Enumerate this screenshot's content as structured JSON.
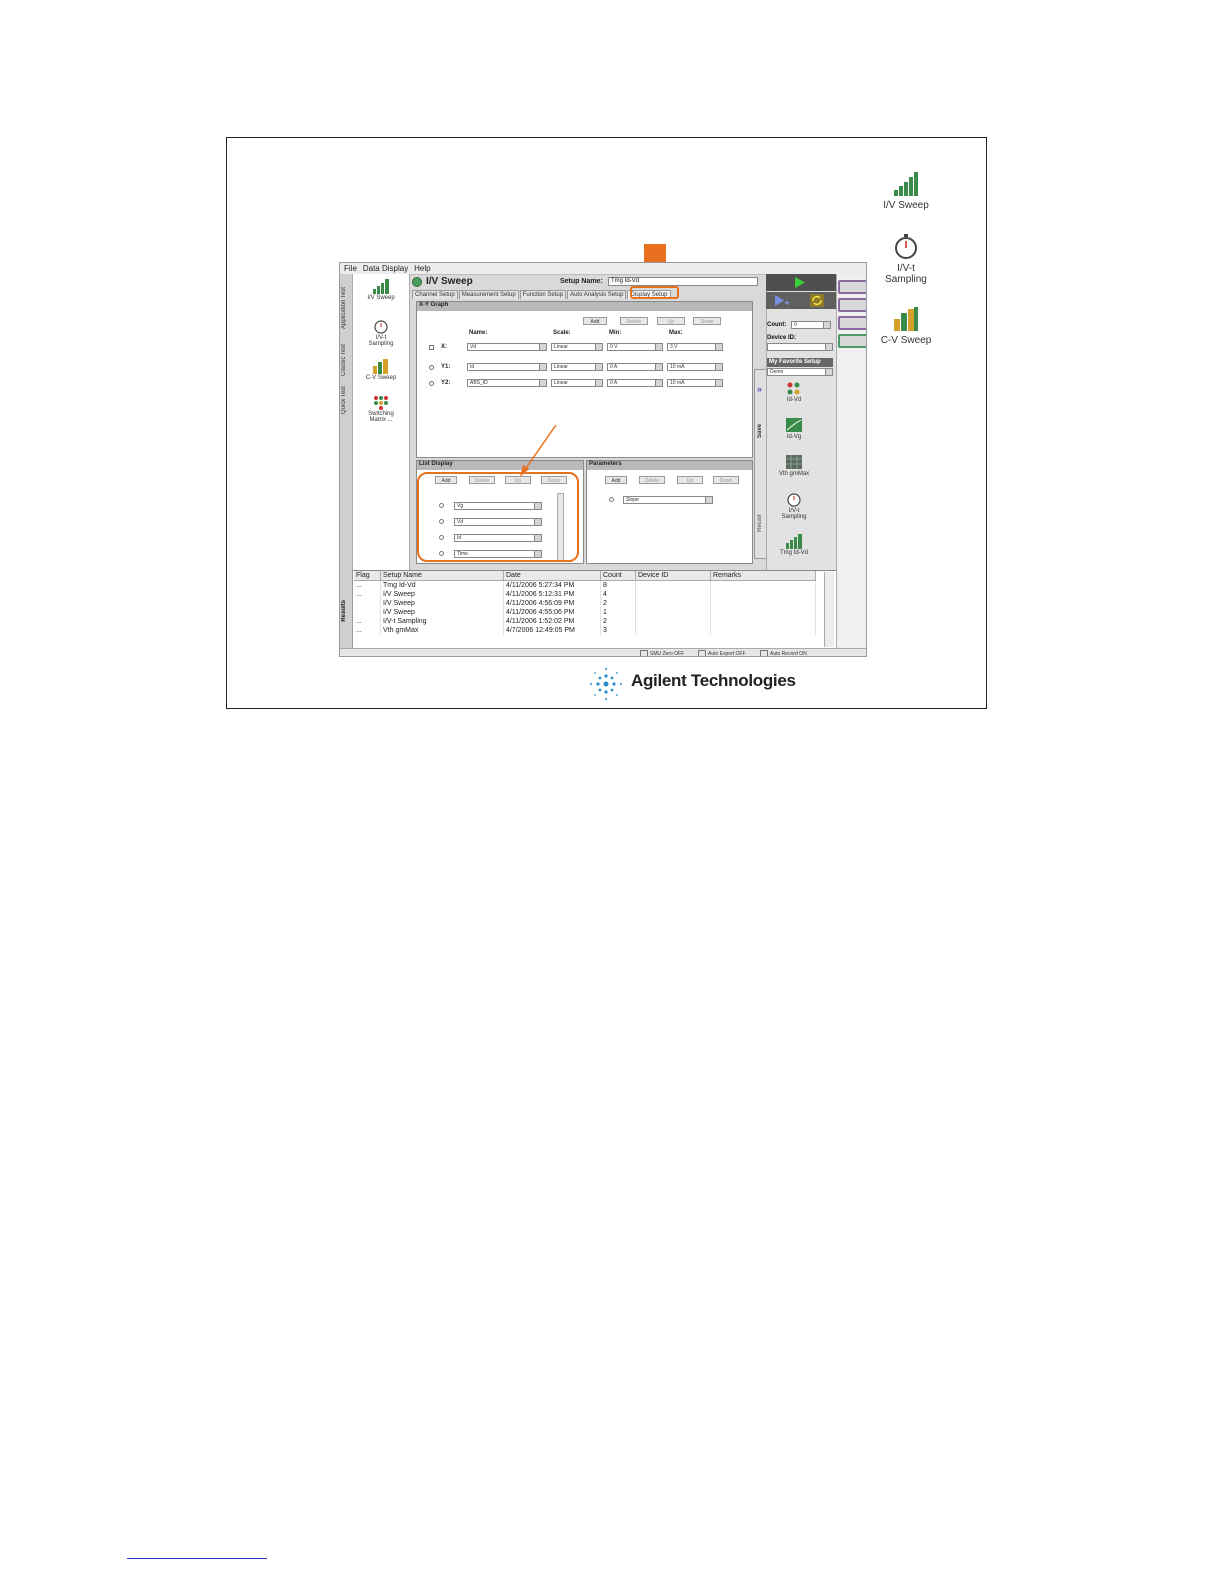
{
  "desktop": {
    "icons": [
      {
        "label": "I/V Sweep",
        "icon": "iv-sweep-icon"
      },
      {
        "label": "I/V-t Sampling",
        "icon": "stopwatch-icon"
      },
      {
        "label": "C-V Sweep",
        "icon": "cv-sweep-icon"
      }
    ]
  },
  "app": {
    "menu": [
      "File",
      "Data Display",
      "Help"
    ],
    "left_tabs": [
      "Application Test",
      "Classic Test",
      "Quick Test"
    ],
    "left_items": [
      {
        "label": "I/V Sweep"
      },
      {
        "label": "I/V-t Sampling"
      },
      {
        "label": "C-V Sweep"
      },
      {
        "label": "Switching Matrix ..."
      }
    ],
    "title": "I/V Sweep",
    "setup_name_label": "Setup Name:",
    "setup_name_value": "Tmg Id-Vd",
    "tabs": [
      "Channel Setup",
      "Measurement Setup",
      "Function Setup",
      "Auto Analysis Setup",
      "Display Setup"
    ],
    "active_tab": "Display Setup",
    "xy_graph": {
      "header": "X-Y Graph",
      "buttons": [
        "Add",
        "Delete",
        "Up",
        "Down"
      ],
      "columns": {
        "name": "Name:",
        "scale": "Scale:",
        "min": "Min:",
        "max": "Max:"
      },
      "rows": [
        {
          "axis": "X:",
          "name": "Vd",
          "scale": "Linear",
          "min": "0 V",
          "max": "3 V"
        },
        {
          "axis": "Y1:",
          "name": "Id",
          "scale": "Linear",
          "min": "0 A",
          "max": "10 mA"
        },
        {
          "axis": "Y2:",
          "name": "ABS_ID",
          "scale": "Linear",
          "min": "0 A",
          "max": "10 mA"
        }
      ]
    },
    "list_display": {
      "header": "List Display",
      "buttons": [
        "Add",
        "Delete",
        "Up",
        "Down"
      ],
      "items": [
        "Vg",
        "Vd",
        "Id",
        "Time"
      ]
    },
    "parameters": {
      "header": "Parameters",
      "buttons": [
        "Add",
        "Delete",
        "Up",
        "Down"
      ],
      "items": [
        "Slope"
      ]
    },
    "save_label": "Save",
    "recall_label": "Recall",
    "right": {
      "count_label": "Count:",
      "count_value": "0",
      "device_id_label": "Device ID:",
      "favorite_label": "My Favorite Setup",
      "favorite_value": "Demo",
      "favorites": [
        "Id-Vd",
        "Id-Vg",
        "Vth gmMax",
        "I/V-t Sampling",
        "Tmg Id-Vd"
      ]
    },
    "results": {
      "tab_label": "Results",
      "columns": [
        "Flag",
        "Setup Name",
        "Date",
        "Count",
        "Device ID",
        "Remarks"
      ],
      "rows": [
        {
          "flag": "...",
          "name": "Tmg Id-Vd",
          "date": "4/11/2006 5:27:34 PM",
          "count": "8",
          "device": "",
          "remarks": ""
        },
        {
          "flag": "...",
          "name": "I/V Sweep",
          "date": "4/11/2006 5:12:31 PM",
          "count": "4",
          "device": "",
          "remarks": ""
        },
        {
          "flag": "",
          "name": "I/V Sweep",
          "date": "4/11/2006 4:56:09 PM",
          "count": "2",
          "device": "",
          "remarks": ""
        },
        {
          "flag": "",
          "name": "I/V Sweep",
          "date": "4/11/2006 4:55:06 PM",
          "count": "1",
          "device": "",
          "remarks": ""
        },
        {
          "flag": "...",
          "name": "I/V-t Sampling",
          "date": "4/11/2006 1:52:02 PM",
          "count": "2",
          "device": "",
          "remarks": ""
        },
        {
          "flag": "...",
          "name": "Vth gmMax",
          "date": "4/7/2006 12:49:05 PM",
          "count": "3",
          "device": "",
          "remarks": ""
        }
      ]
    },
    "status": [
      "SMU Zero OFF",
      "Auto Export OFF",
      "Auto Record ON"
    ]
  },
  "logo_text": "Agilent Technologies",
  "colors": {
    "highlight": "#e8701f",
    "run_green": "#3ccf3c"
  }
}
